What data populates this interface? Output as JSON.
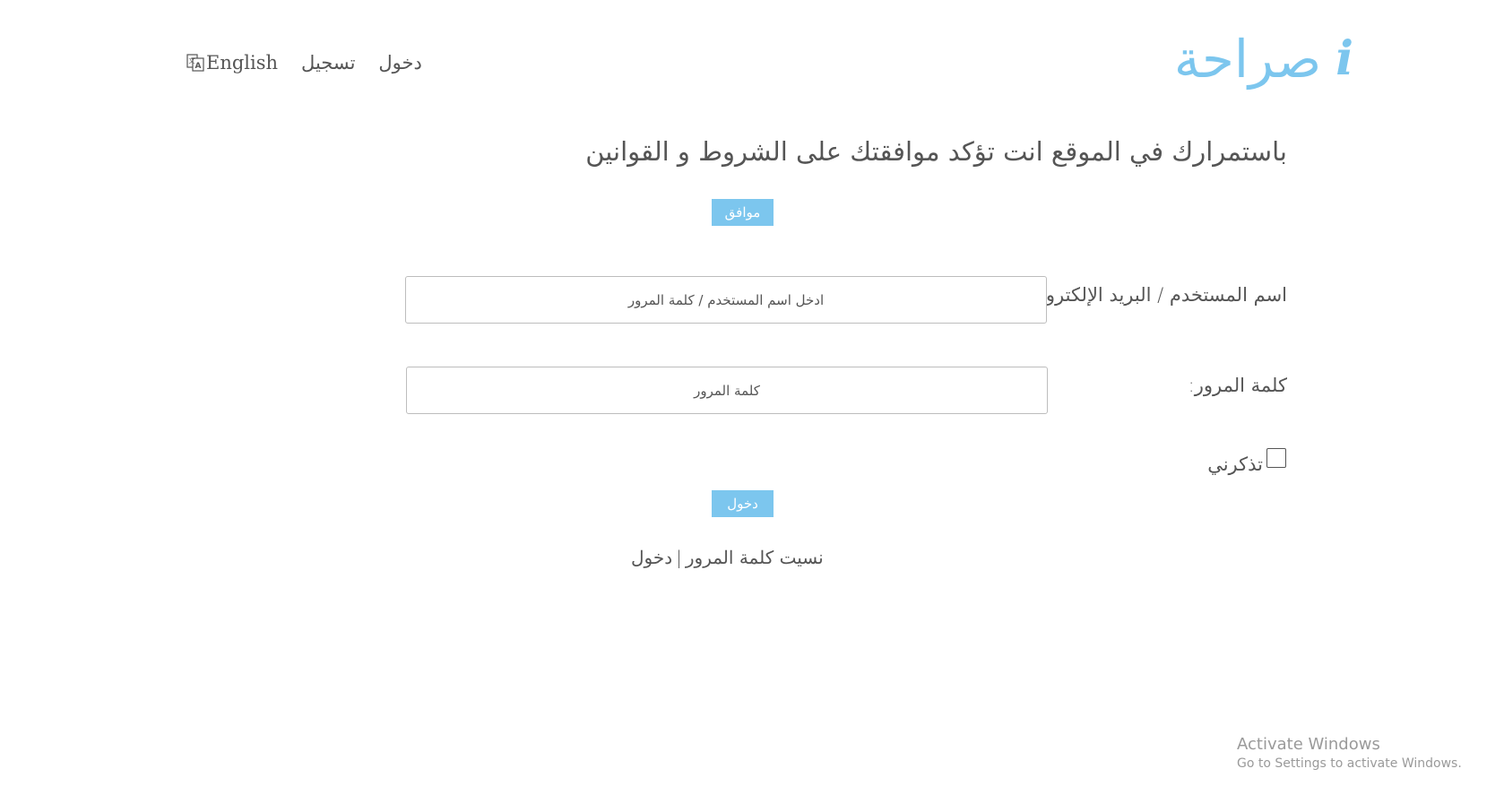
{
  "header": {
    "logo_text": "صراحة",
    "logo_letter": "i",
    "nav": {
      "language": "English",
      "register": "تسجيل",
      "login": "دخول"
    }
  },
  "terms": {
    "notice": "باستمرارك في الموقع انت تؤكد موافقتك على الشروط و القوانين",
    "agree_button": "موافق"
  },
  "form": {
    "username_label": "اسم المستخدم / البريد الإلكتروني:",
    "username_placeholder": "ادخل اسم المستخدم / كلمة المرور",
    "password_label": "كلمة المرور:",
    "password_placeholder": "كلمة المرور",
    "remember_label": "تذكرني",
    "remember_checked": false,
    "login_button": "دخول"
  },
  "links": {
    "forgot_password": "نسيت كلمة المرور",
    "separator": "|",
    "login": "دخول"
  },
  "watermark": {
    "title": "Activate Windows",
    "subtitle": "Go to Settings to activate Windows."
  },
  "colors": {
    "accent": "#7cc6ee",
    "text": "#555555",
    "border": "#bdbdbd"
  }
}
